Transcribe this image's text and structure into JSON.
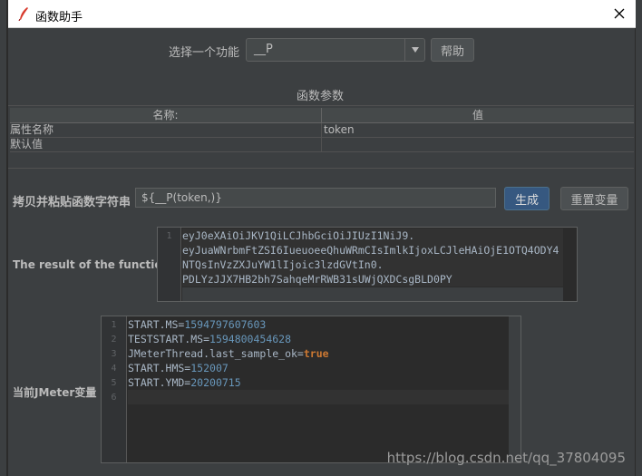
{
  "window": {
    "title": "函数助手",
    "close_label": "×"
  },
  "selector": {
    "label": "选择一个功能",
    "value": "__P",
    "help_label": "帮助"
  },
  "params": {
    "title": "函数参数",
    "columns": [
      "名称:",
      "值"
    ],
    "rows": [
      {
        "name": "属性名称",
        "value": "token"
      },
      {
        "name": "默认值",
        "value": ""
      }
    ]
  },
  "copy": {
    "label": "拷贝并粘贴函数字符串",
    "value": "${__P(token,)}",
    "generate_label": "生成",
    "reset_label": "重置变量"
  },
  "result": {
    "label": "The result of the function is",
    "line_number": "1",
    "lines": [
      "eyJ0eXAiOiJKV1QiLCJhbGciOiJIUzI1NiJ9.",
      "eyJuaWNrbmFtZSI6IueuoeeQhuWRmCIsImlkIjoxLCJleHAiOjE1OTQ4ODY4",
      "NTQsInVzZXJuYW1lIjoic3lzdGVtIn0.",
      "PDLYzJJX7HB2bh7SahqeMrRWB31sUWjQXDCsgBLD0PY"
    ]
  },
  "variables": {
    "label": "当前JMeter变量",
    "lines": [
      {
        "n": "1",
        "key": "START.MS=",
        "val": "1594797607603",
        "type": "num"
      },
      {
        "n": "2",
        "key": "TESTSTART.MS=",
        "val": "1594800454628",
        "type": "num"
      },
      {
        "n": "3",
        "key": "JMeterThread.last_sample_ok=",
        "val": "true",
        "type": "kw"
      },
      {
        "n": "4",
        "key": "START.HMS=",
        "val": "152007",
        "type": "num"
      },
      {
        "n": "5",
        "key": "START.YMD=",
        "val": "20200715",
        "type": "num"
      },
      {
        "n": "6",
        "key": "",
        "val": "",
        "type": "num"
      }
    ]
  },
  "watermark": "https://blog.csdn.net/qq_37804095",
  "colors": {
    "background": "#3c3f41",
    "editor_bg": "#2b2b2b",
    "number": "#6897bb",
    "keyword": "#cc7832",
    "primary_button": "#365880"
  }
}
